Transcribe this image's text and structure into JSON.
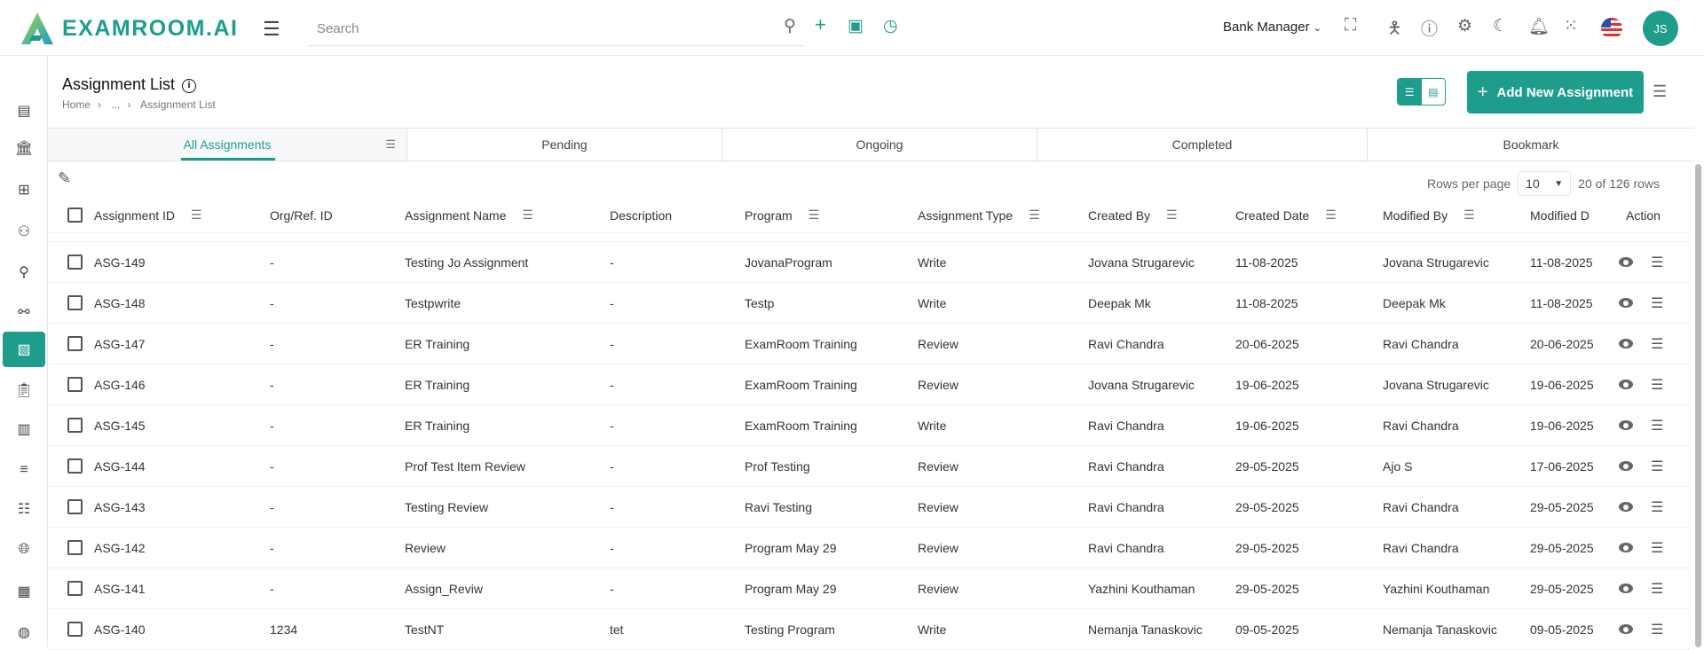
{
  "header": {
    "brand": "EXAMROOM.AI",
    "search_placeholder": "Search",
    "role": "Bank Manager",
    "avatar_initials": "JS"
  },
  "page": {
    "title": "Assignment List",
    "breadcrumb": [
      "Home",
      "...",
      "Assignment List"
    ],
    "add_button": "Add New Assignment"
  },
  "tabs": [
    "All Assignments",
    "Pending",
    "Ongoing",
    "Completed",
    "Bookmark"
  ],
  "pagination": {
    "rows_per_page_label": "Rows per page",
    "rows_per_page": "10",
    "summary": "20 of 126 rows"
  },
  "columns": [
    "Assignment ID",
    "Org/Ref. ID",
    "Assignment Name",
    "Description",
    "Program",
    "Assignment Type",
    "Created By",
    "Created Date",
    "Modified By",
    "Modified D",
    "Action"
  ],
  "rows": [
    [
      "ASG-149",
      "-",
      "Testing Jo Assignment",
      "-",
      "JovanaProgram",
      "Write",
      "Jovana Strugarevic",
      "11-08-2025",
      "Jovana Strugarevic",
      "11-08-2025"
    ],
    [
      "ASG-148",
      "-",
      "Testpwrite",
      "-",
      "Testp",
      "Write",
      "Deepak Mk",
      "11-08-2025",
      "Deepak Mk",
      "11-08-2025"
    ],
    [
      "ASG-147",
      "-",
      "ER Training",
      "-",
      "ExamRoom Training",
      "Review",
      "Ravi Chandra",
      "20-06-2025",
      "Ravi Chandra",
      "20-06-2025"
    ],
    [
      "ASG-146",
      "-",
      "ER Training",
      "-",
      "ExamRoom Training",
      "Review",
      "Jovana Strugarevic",
      "19-06-2025",
      "Jovana Strugarevic",
      "19-06-2025"
    ],
    [
      "ASG-145",
      "-",
      "ER Training",
      "-",
      "ExamRoom Training",
      "Write",
      "Ravi Chandra",
      "19-06-2025",
      "Ravi Chandra",
      "19-06-2025"
    ],
    [
      "ASG-144",
      "-",
      "Prof Test Item Review",
      "-",
      "Prof Testing",
      "Review",
      "Ravi Chandra",
      "29-05-2025",
      "Ajo S",
      "17-06-2025"
    ],
    [
      "ASG-143",
      "-",
      "Testing Review",
      "-",
      "Ravi Testing",
      "Review",
      "Ravi Chandra",
      "29-05-2025",
      "Ravi Chandra",
      "29-05-2025"
    ],
    [
      "ASG-142",
      "-",
      "Review",
      "-",
      "Program May 29",
      "Review",
      "Ravi Chandra",
      "29-05-2025",
      "Ravi Chandra",
      "29-05-2025"
    ],
    [
      "ASG-141",
      "-",
      "Assign_Reviw",
      "-",
      "Program May 29",
      "Review",
      "Yazhini Kouthaman",
      "29-05-2025",
      "Yazhini Kouthaman",
      "29-05-2025"
    ],
    [
      "ASG-140",
      "1234",
      "TestNT",
      "tet",
      "Testing Program",
      "Write",
      "Nemanja Tanaskovic",
      "09-05-2025",
      "Nemanja Tanaskovic",
      "09-05-2025"
    ]
  ],
  "colors": {
    "accent": "#1f9d8c"
  }
}
